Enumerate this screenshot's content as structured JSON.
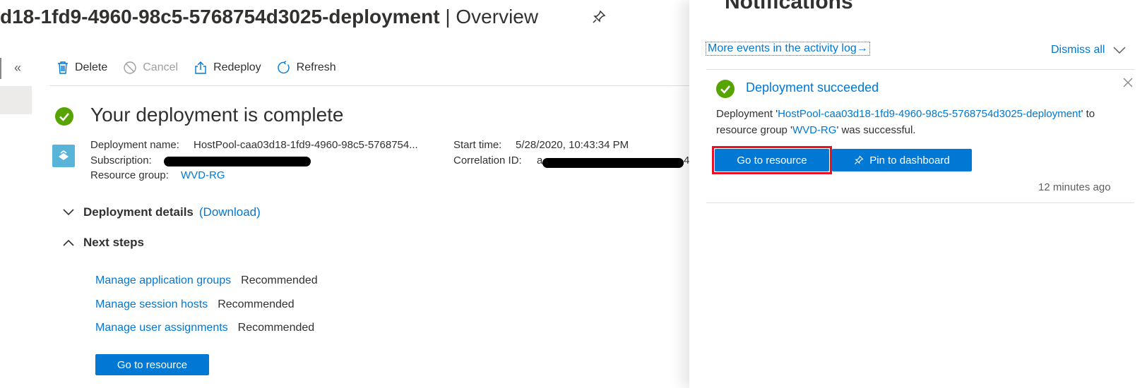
{
  "page": {
    "title_bold": "d18-1fd9-4960-98c5-5768754d3025-deployment",
    "title_sep": " | ",
    "title_light": "Overview"
  },
  "toolbar": {
    "delete": "Delete",
    "cancel": "Cancel",
    "redeploy": "Redeploy",
    "refresh": "Refresh"
  },
  "status": {
    "heading": "Your deployment is complete"
  },
  "details": {
    "deployment_name_label": "Deployment name:",
    "deployment_name_value": "HostPool-caa03d18-1fd9-4960-98c5-5768754...",
    "subscription_label": "Subscription:",
    "resource_group_label": "Resource group:",
    "resource_group_value": "WVD-RG",
    "start_time_label": "Start time:",
    "start_time_value": "5/28/2020, 10:43:34 PM",
    "correlation_label": "Correlation ID:",
    "correlation_prefix": "a",
    "correlation_suffix": "4"
  },
  "sections": {
    "deployment_details": "Deployment details",
    "download": "(Download)",
    "next_steps": "Next steps"
  },
  "next_steps": [
    {
      "link": "Manage application groups",
      "tag": "Recommended"
    },
    {
      "link": "Manage session hosts",
      "tag": "Recommended"
    },
    {
      "link": "Manage user assignments",
      "tag": "Recommended"
    }
  ],
  "main_go_to_resource": "Go to resource",
  "notifications": {
    "panel_title": "Notifications",
    "activity_link": "More events in the activity log",
    "activity_arrow": "→",
    "dismiss_all": "Dismiss all",
    "item": {
      "title": "Deployment succeeded",
      "body_prefix": "Deployment '",
      "deployment_link": "HostPool-caa03d18-1fd9-4960-98c5-5768754d3025-deployment",
      "body_middle": "' to resource group '",
      "rg_link": "WVD-RG",
      "body_suffix": "' was successful.",
      "go_to_resource": "Go to resource",
      "pin_to_dashboard": "Pin to dashboard",
      "time": "12 minutes ago"
    }
  },
  "colors": {
    "accent": "#0078d4",
    "success": "#57a300",
    "highlight": "#e81123"
  }
}
